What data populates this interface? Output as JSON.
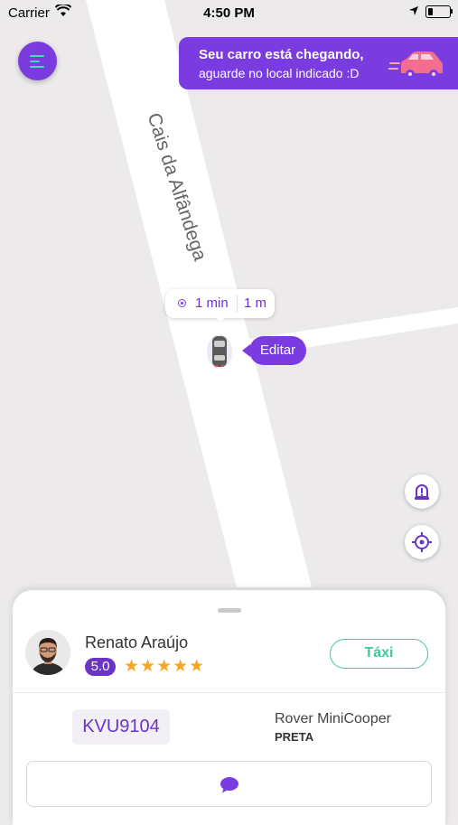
{
  "status_bar": {
    "carrier": "Carrier",
    "time": "4:50 PM"
  },
  "banner": {
    "title": "Seu carro está chegando,",
    "subtitle": "aguarde no local indicado :D"
  },
  "map": {
    "street_name": "Cais da Alfândega",
    "eta": {
      "time": "1 min",
      "distance": "1 m"
    },
    "edit_label": "Editar"
  },
  "driver": {
    "name": "Renato Araújo",
    "rating": "5.0",
    "stars": "★★★★★",
    "category": "Táxi"
  },
  "vehicle": {
    "plate": "KVU9104",
    "model": "Rover MiniCooper",
    "color": "PRETA"
  },
  "icons": {
    "menu": "menu-icon",
    "car": "car-icon",
    "alert": "alert-beacon-icon",
    "gps": "gps-locate-icon",
    "chat": "chat-bubble-icon",
    "wifi": "wifi-icon",
    "location": "location-arrow-icon",
    "battery": "battery-icon"
  },
  "colors": {
    "accent": "#7a3ce0",
    "green": "#3ec99b",
    "star": "#f5a623",
    "map": "#eceaea"
  }
}
